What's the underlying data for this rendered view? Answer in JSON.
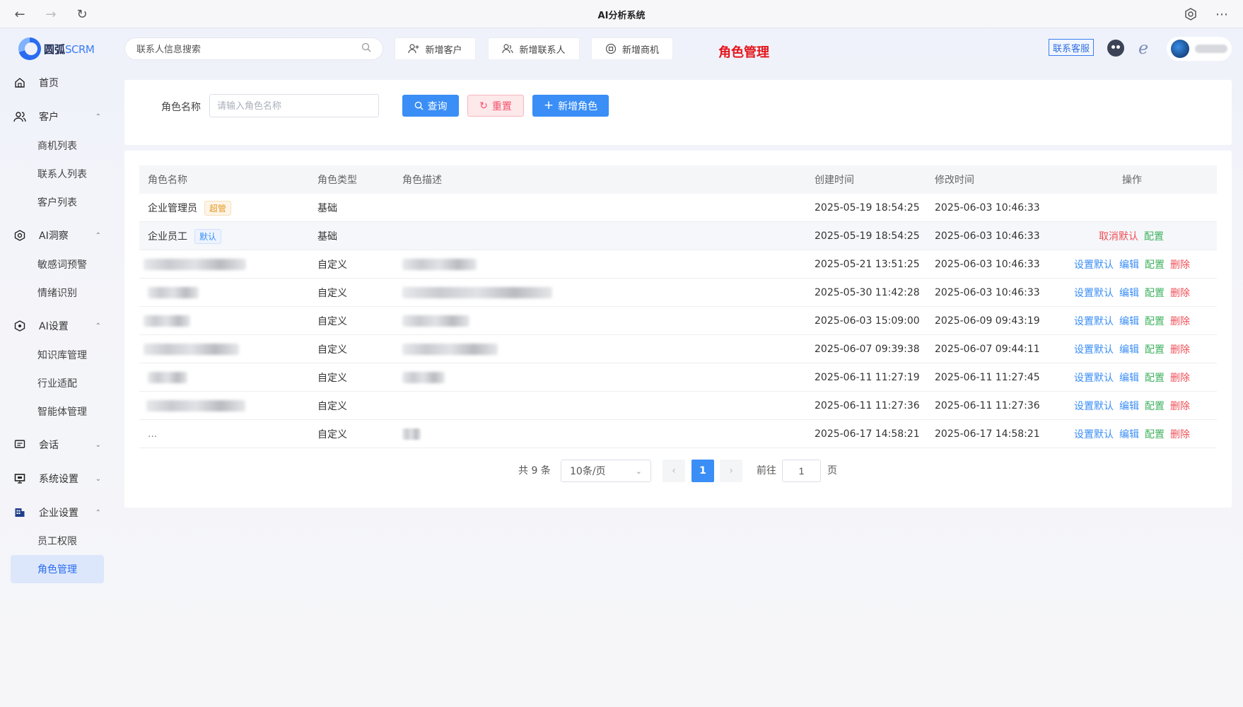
{
  "browser": {
    "title": "AI分析系统"
  },
  "header": {
    "logo_text_cn": "圆弧",
    "logo_text_en": "SCRM",
    "search_placeholder": "联系人信息搜索",
    "buttons": [
      "新增客户",
      "新增联系人",
      "新增商机"
    ],
    "page_heading": "角色管理",
    "contact_service": "联系客服"
  },
  "sidebar": {
    "home": "首页",
    "customer": "客户",
    "customer_items": [
      "商机列表",
      "联系人列表",
      "客户列表"
    ],
    "ai_insight": "AI洞察",
    "ai_insight_items": [
      "敏感词预警",
      "情绪识别"
    ],
    "ai_settings": "AI设置",
    "ai_settings_items": [
      "知识库管理",
      "行业适配",
      "智能体管理"
    ],
    "chat": "会话",
    "system_settings": "系统设置",
    "enterprise_settings": "企业设置",
    "enterprise_items": [
      "员工权限",
      "角色管理"
    ]
  },
  "filter": {
    "label": "角色名称",
    "placeholder": "请输入角色名称",
    "query": "查询",
    "reset": "重置",
    "add_role": "新增角色"
  },
  "table": {
    "headers": [
      "角色名称",
      "角色类型",
      "角色描述",
      "创建时间",
      "修改时间",
      "操作"
    ],
    "rows": [
      {
        "name": "企业管理员",
        "tag": "超管",
        "type": "基础",
        "created": "2025-05-19 18:54:25",
        "modified": "2025-06-03 10:46:33",
        "actions": []
      },
      {
        "name": "企业员工",
        "tag": "默认",
        "type": "基础",
        "created": "2025-05-19 18:54:25",
        "modified": "2025-06-03 10:46:33",
        "actions": [
          "取消默认",
          "配置"
        ]
      },
      {
        "name": "",
        "type": "自定义",
        "created": "2025-05-21 13:51:25",
        "modified": "2025-06-03 10:46:33",
        "actions": [
          "设置默认",
          "编辑",
          "配置",
          "删除"
        ]
      },
      {
        "name": "",
        "type": "自定义",
        "created": "2025-05-30 11:42:28",
        "modified": "2025-06-03 10:46:33",
        "actions": [
          "设置默认",
          "编辑",
          "配置",
          "删除"
        ]
      },
      {
        "name": "",
        "type": "自定义",
        "created": "2025-06-03 15:09:00",
        "modified": "2025-06-09 09:43:19",
        "actions": [
          "设置默认",
          "编辑",
          "配置",
          "删除"
        ]
      },
      {
        "name": "",
        "type": "自定义",
        "created": "2025-06-07 09:39:38",
        "modified": "2025-06-07 09:44:11",
        "actions": [
          "设置默认",
          "编辑",
          "配置",
          "删除"
        ]
      },
      {
        "name": "",
        "type": "自定义",
        "created": "2025-06-11 11:27:19",
        "modified": "2025-06-11 11:27:45",
        "actions": [
          "设置默认",
          "编辑",
          "配置",
          "删除"
        ]
      },
      {
        "name": "",
        "type": "自定义",
        "created": "2025-06-11 11:27:36",
        "modified": "2025-06-11 11:27:36",
        "actions": [
          "设置默认",
          "编辑",
          "配置",
          "删除"
        ]
      },
      {
        "name": "...",
        "type": "自定义",
        "created": "2025-06-17 14:58:21",
        "modified": "2025-06-17 14:58:21",
        "actions": [
          "设置默认",
          "编辑",
          "配置",
          "删除"
        ]
      }
    ]
  },
  "pagination": {
    "total": "共 9 条",
    "page_size": "10条/页",
    "current_page": "1",
    "goto_label": "前往",
    "goto_value": "1",
    "page_suffix": "页"
  },
  "colors": {
    "primary": "#3a8ef6",
    "danger": "#ee4f56",
    "success": "#3fb25f",
    "heading_red": "#e5151b"
  }
}
